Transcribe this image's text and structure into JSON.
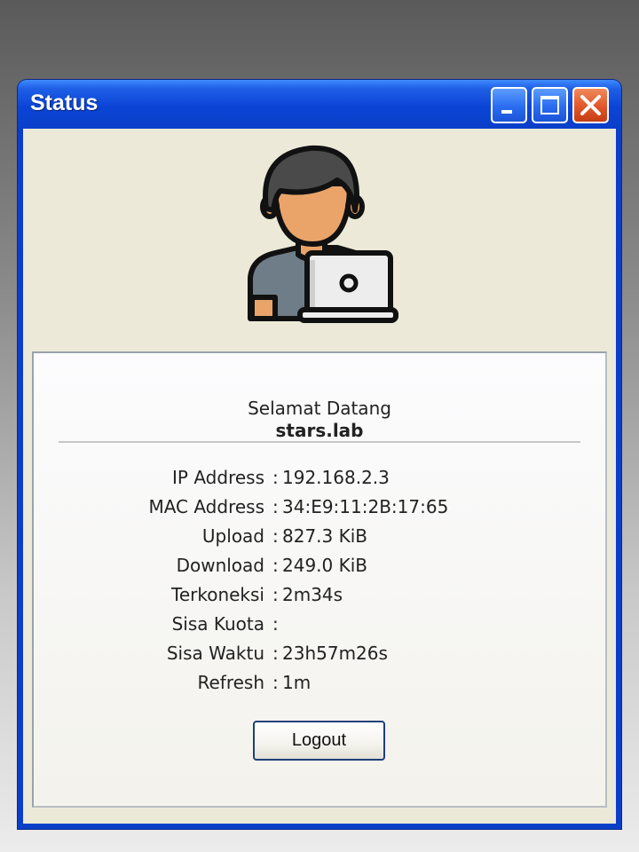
{
  "window": {
    "title": "Status",
    "controls": {
      "minimize": "minimize-icon",
      "maximize": "maximize-icon",
      "close": "close-icon"
    }
  },
  "avatar": {
    "icon": "user-laptop-icon"
  },
  "panel": {
    "welcome": "Selamat Datang",
    "username": "stars.lab",
    "separator": ":",
    "rows": [
      {
        "label": "IP Address",
        "value": "192.168.2.3"
      },
      {
        "label": "MAC Address",
        "value": "34:E9:11:2B:17:65"
      },
      {
        "label": "Upload",
        "value": "827.3 KiB"
      },
      {
        "label": "Download",
        "value": "249.0 KiB"
      },
      {
        "label": "Terkoneksi",
        "value": "2m34s"
      },
      {
        "label": "Sisa Kuota",
        "value": ""
      },
      {
        "label": "Sisa Waktu",
        "value": "23h57m26s"
      },
      {
        "label": "Refresh",
        "value": "1m"
      }
    ],
    "logout_label": "Logout"
  },
  "colors": {
    "titlebar": "#0a3fc8",
    "close_button": "#e0562a",
    "client_bg": "#ece9d8"
  }
}
